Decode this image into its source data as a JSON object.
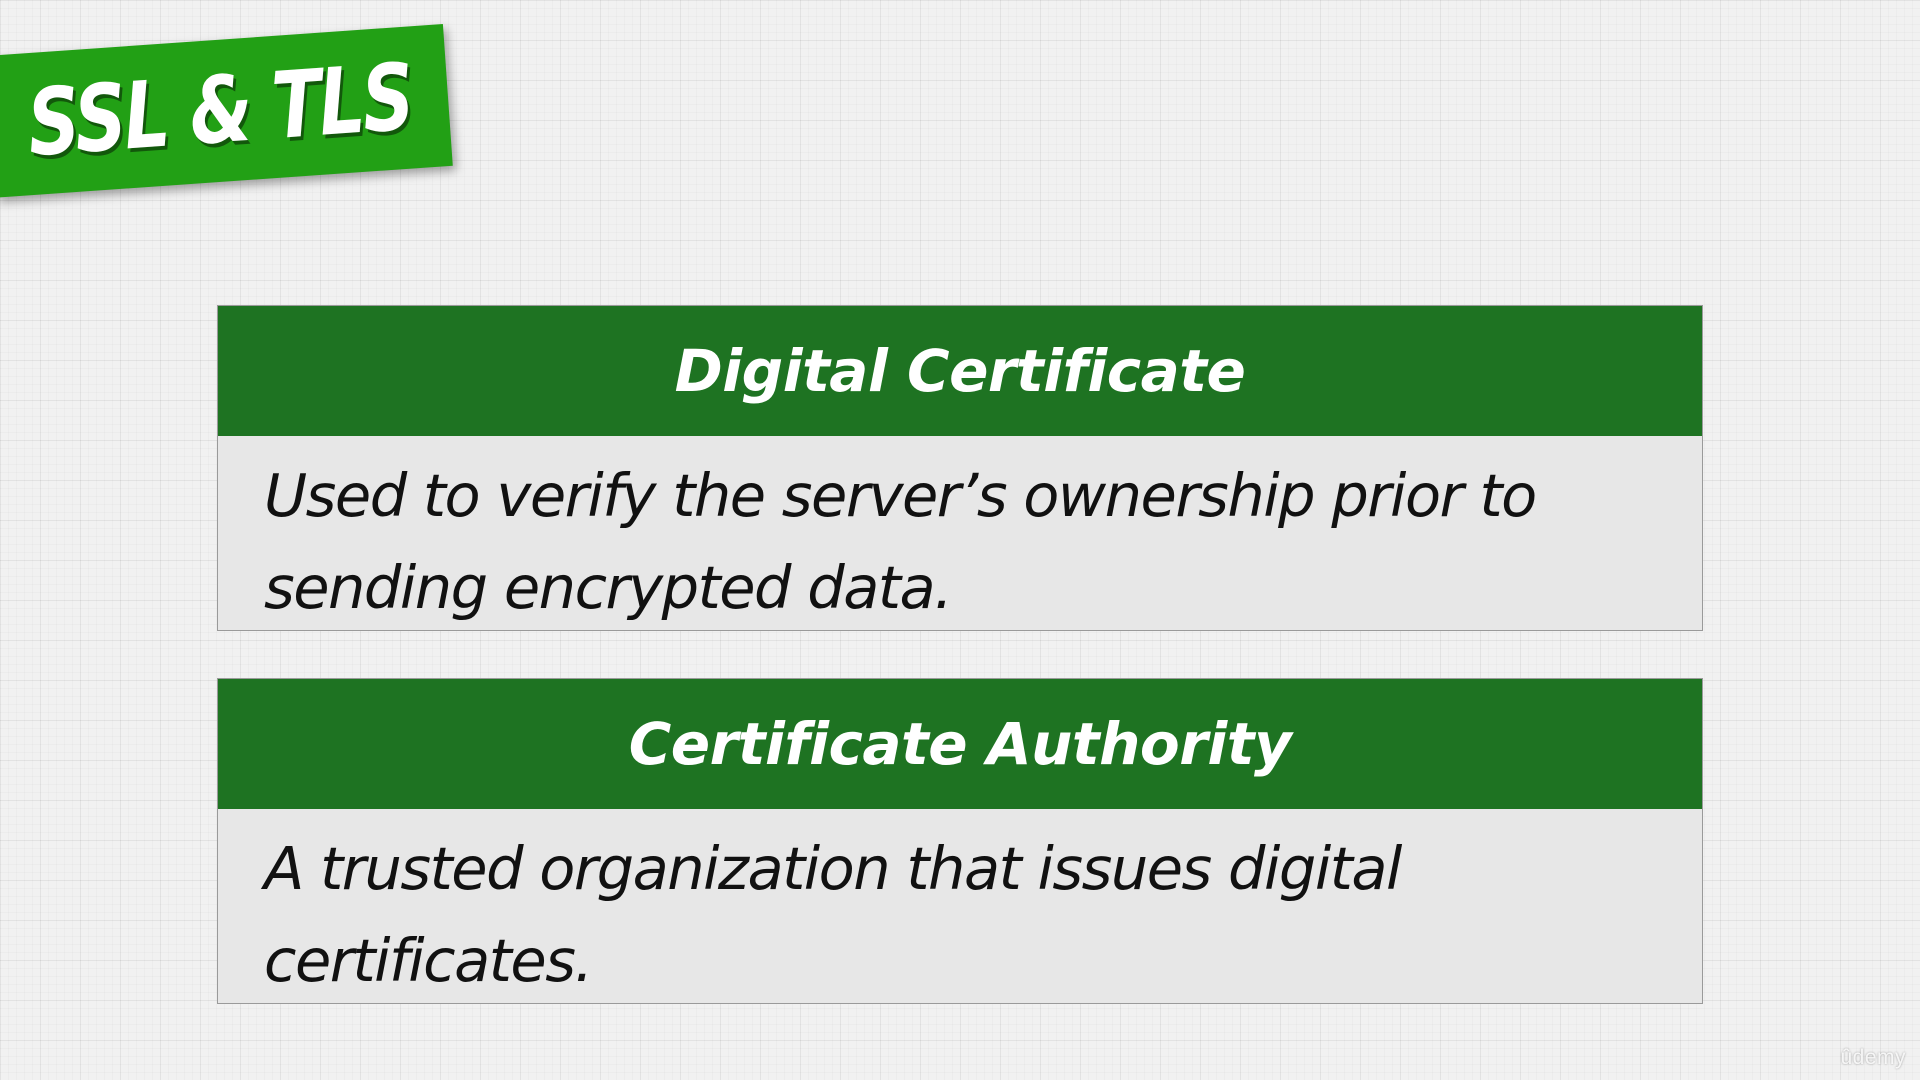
{
  "slide": {
    "title": "SSL & TLS",
    "accent_colors": {
      "title_banner": "#22a015",
      "card_header": "#1e7322",
      "card_body": "#e7e7e7"
    },
    "cards": [
      {
        "heading": "Digital Certificate",
        "text": "Used to verify the server’s ownership prior to sending encrypted data."
      },
      {
        "heading": "Certificate Authority",
        "text": "A trusted organization that issues digital certificates."
      }
    ],
    "watermark": "ûdemy"
  }
}
